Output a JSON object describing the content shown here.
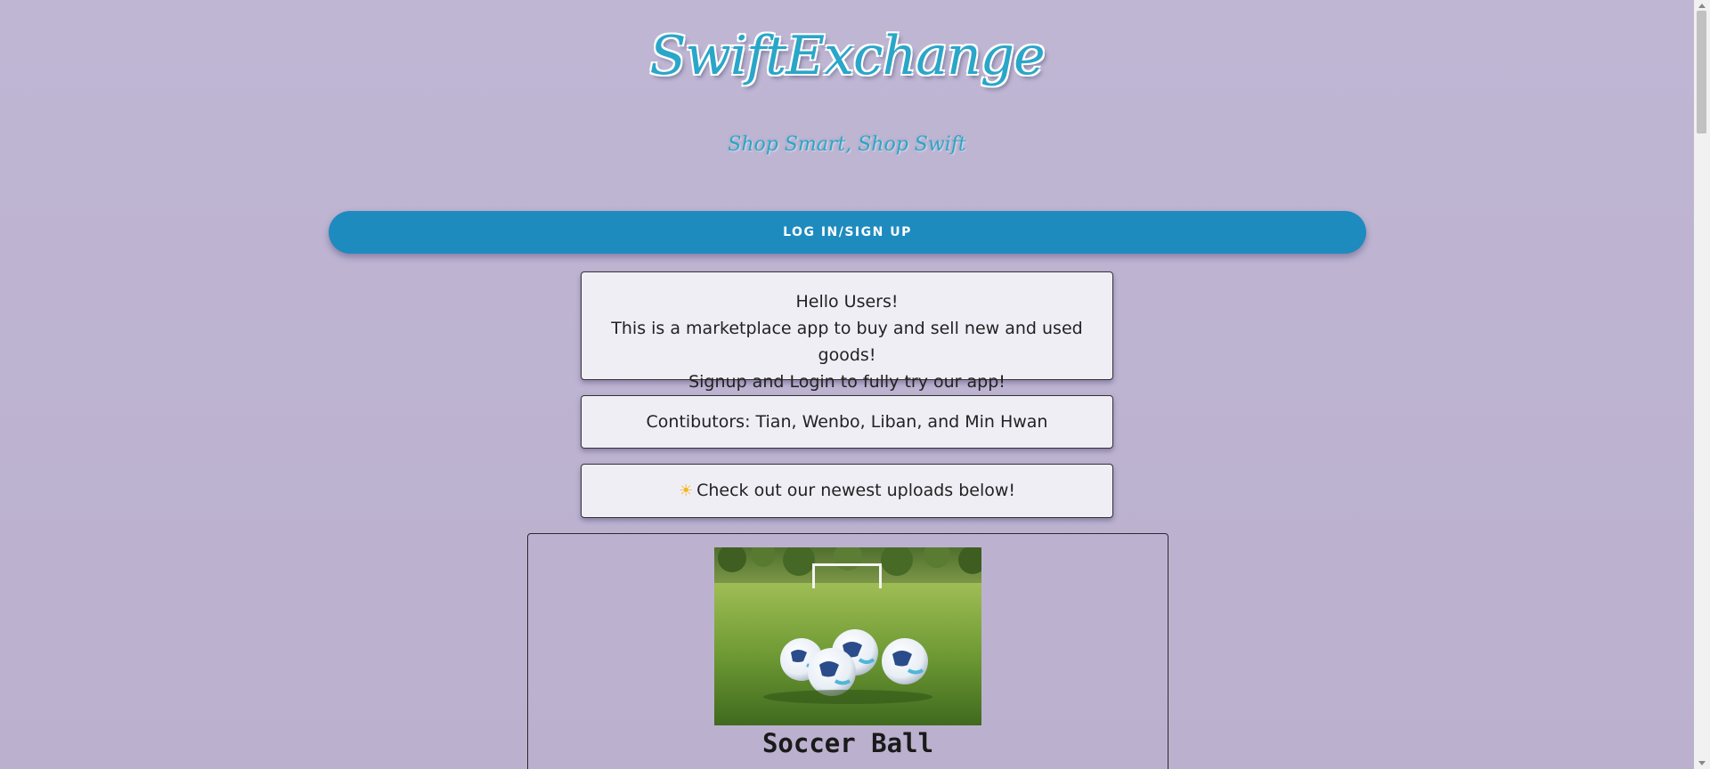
{
  "header": {
    "brand": "SwiftExchange",
    "tagline": "Shop Smart, Shop Swift"
  },
  "auth": {
    "login_label": "LOG IN/SIGN UP"
  },
  "intro": {
    "line1": "Hello Users!",
    "line2": "This is a marketplace app to buy and sell new and used goods!",
    "line3": "Signup and Login to fully try our app!"
  },
  "contributors": "Contibutors: Tian, Wenbo, Liban, and Min Hwan",
  "newest": {
    "icon": "sun-icon",
    "text": "Check out our newest uploads below!"
  },
  "products": [
    {
      "title": "Soccer Ball",
      "image": "soccer-balls-on-grass-photo"
    }
  ],
  "colors": {
    "background": "#bdb4d2",
    "accent": "#1e8bbf",
    "brand_text": "#2aa6c8",
    "card_bg": "#f0eef5"
  }
}
